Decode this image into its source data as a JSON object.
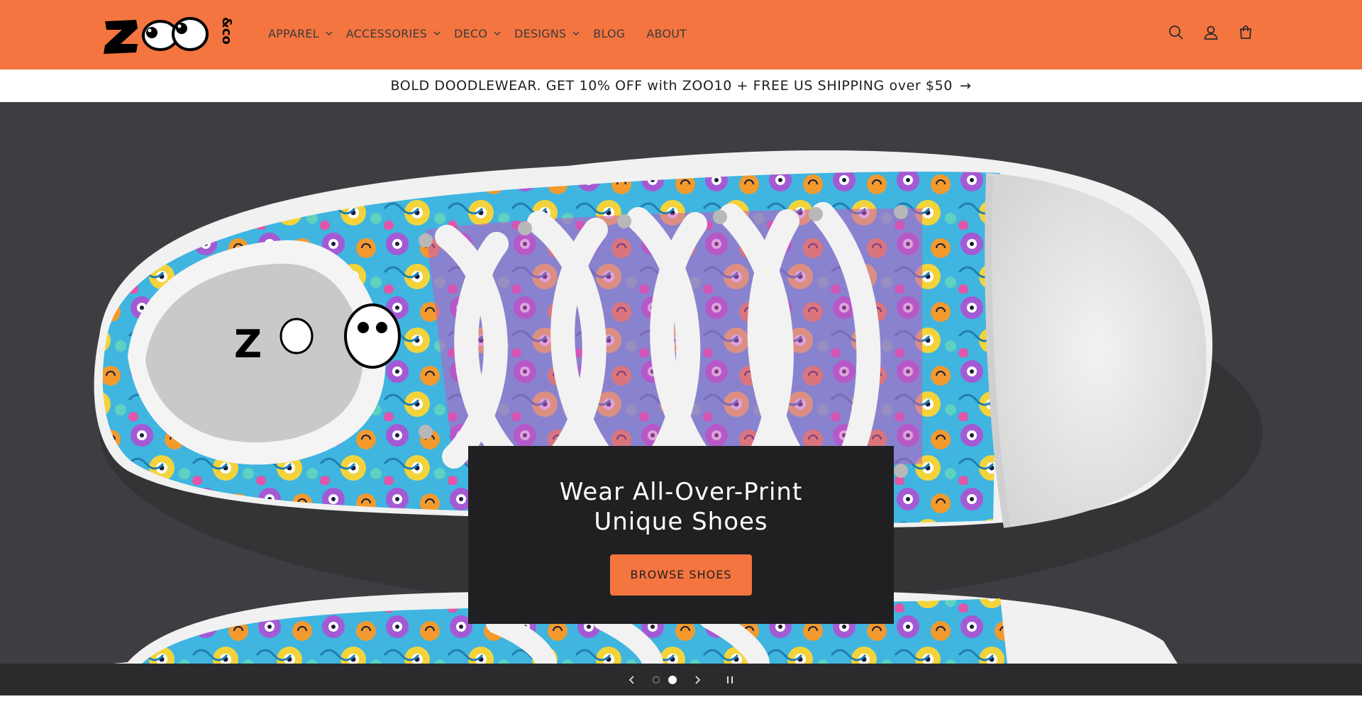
{
  "header": {
    "logo_text": "Z&CO",
    "brand_color": "#f47540",
    "nav": [
      {
        "label": "APPAREL",
        "dropdown": true
      },
      {
        "label": "ACCESSORIES",
        "dropdown": true
      },
      {
        "label": "DECO",
        "dropdown": true
      },
      {
        "label": "DESIGNS",
        "dropdown": true
      },
      {
        "label": "BLOG",
        "dropdown": false
      },
      {
        "label": "ABOUT",
        "dropdown": false
      }
    ],
    "icons": [
      "search-icon",
      "account-icon",
      "cart-icon"
    ]
  },
  "announcement": {
    "text": "BOLD DOODLEWEAR. GET 10% OFF with ZOO10 + FREE US SHIPPING over $50",
    "arrow": "→"
  },
  "hero": {
    "title": "Wear All-Over-Print Unique Shoes",
    "button_label": "BROWSE SHOES",
    "image": "patterned-high-top-sneaker"
  },
  "slider": {
    "slide_count": 2,
    "active_slide": 2,
    "prev_icon": "‹",
    "next_icon": "›",
    "pause_icon": "❚❚"
  },
  "colors": {
    "accent": "#f47540",
    "hero_box": "#202022",
    "slider_bar": "#2b2b2d"
  }
}
